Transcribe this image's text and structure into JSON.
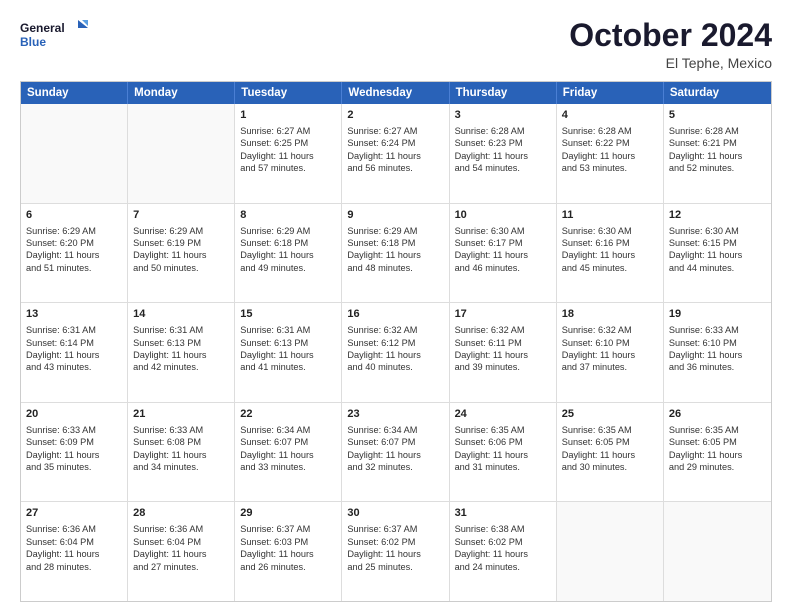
{
  "header": {
    "logo_general": "General",
    "logo_blue": "Blue",
    "month": "October 2024",
    "location": "El Tephe, Mexico"
  },
  "days": [
    "Sunday",
    "Monday",
    "Tuesday",
    "Wednesday",
    "Thursday",
    "Friday",
    "Saturday"
  ],
  "rows": [
    [
      {
        "day": "",
        "empty": true
      },
      {
        "day": "",
        "empty": true
      },
      {
        "day": "1",
        "line1": "Sunrise: 6:27 AM",
        "line2": "Sunset: 6:25 PM",
        "line3": "Daylight: 11 hours",
        "line4": "and 57 minutes."
      },
      {
        "day": "2",
        "line1": "Sunrise: 6:27 AM",
        "line2": "Sunset: 6:24 PM",
        "line3": "Daylight: 11 hours",
        "line4": "and 56 minutes."
      },
      {
        "day": "3",
        "line1": "Sunrise: 6:28 AM",
        "line2": "Sunset: 6:23 PM",
        "line3": "Daylight: 11 hours",
        "line4": "and 54 minutes."
      },
      {
        "day": "4",
        "line1": "Sunrise: 6:28 AM",
        "line2": "Sunset: 6:22 PM",
        "line3": "Daylight: 11 hours",
        "line4": "and 53 minutes."
      },
      {
        "day": "5",
        "line1": "Sunrise: 6:28 AM",
        "line2": "Sunset: 6:21 PM",
        "line3": "Daylight: 11 hours",
        "line4": "and 52 minutes."
      }
    ],
    [
      {
        "day": "6",
        "line1": "Sunrise: 6:29 AM",
        "line2": "Sunset: 6:20 PM",
        "line3": "Daylight: 11 hours",
        "line4": "and 51 minutes."
      },
      {
        "day": "7",
        "line1": "Sunrise: 6:29 AM",
        "line2": "Sunset: 6:19 PM",
        "line3": "Daylight: 11 hours",
        "line4": "and 50 minutes."
      },
      {
        "day": "8",
        "line1": "Sunrise: 6:29 AM",
        "line2": "Sunset: 6:18 PM",
        "line3": "Daylight: 11 hours",
        "line4": "and 49 minutes."
      },
      {
        "day": "9",
        "line1": "Sunrise: 6:29 AM",
        "line2": "Sunset: 6:18 PM",
        "line3": "Daylight: 11 hours",
        "line4": "and 48 minutes."
      },
      {
        "day": "10",
        "line1": "Sunrise: 6:30 AM",
        "line2": "Sunset: 6:17 PM",
        "line3": "Daylight: 11 hours",
        "line4": "and 46 minutes."
      },
      {
        "day": "11",
        "line1": "Sunrise: 6:30 AM",
        "line2": "Sunset: 6:16 PM",
        "line3": "Daylight: 11 hours",
        "line4": "and 45 minutes."
      },
      {
        "day": "12",
        "line1": "Sunrise: 6:30 AM",
        "line2": "Sunset: 6:15 PM",
        "line3": "Daylight: 11 hours",
        "line4": "and 44 minutes."
      }
    ],
    [
      {
        "day": "13",
        "line1": "Sunrise: 6:31 AM",
        "line2": "Sunset: 6:14 PM",
        "line3": "Daylight: 11 hours",
        "line4": "and 43 minutes."
      },
      {
        "day": "14",
        "line1": "Sunrise: 6:31 AM",
        "line2": "Sunset: 6:13 PM",
        "line3": "Daylight: 11 hours",
        "line4": "and 42 minutes."
      },
      {
        "day": "15",
        "line1": "Sunrise: 6:31 AM",
        "line2": "Sunset: 6:13 PM",
        "line3": "Daylight: 11 hours",
        "line4": "and 41 minutes."
      },
      {
        "day": "16",
        "line1": "Sunrise: 6:32 AM",
        "line2": "Sunset: 6:12 PM",
        "line3": "Daylight: 11 hours",
        "line4": "and 40 minutes."
      },
      {
        "day": "17",
        "line1": "Sunrise: 6:32 AM",
        "line2": "Sunset: 6:11 PM",
        "line3": "Daylight: 11 hours",
        "line4": "and 39 minutes."
      },
      {
        "day": "18",
        "line1": "Sunrise: 6:32 AM",
        "line2": "Sunset: 6:10 PM",
        "line3": "Daylight: 11 hours",
        "line4": "and 37 minutes."
      },
      {
        "day": "19",
        "line1": "Sunrise: 6:33 AM",
        "line2": "Sunset: 6:10 PM",
        "line3": "Daylight: 11 hours",
        "line4": "and 36 minutes."
      }
    ],
    [
      {
        "day": "20",
        "line1": "Sunrise: 6:33 AM",
        "line2": "Sunset: 6:09 PM",
        "line3": "Daylight: 11 hours",
        "line4": "and 35 minutes."
      },
      {
        "day": "21",
        "line1": "Sunrise: 6:33 AM",
        "line2": "Sunset: 6:08 PM",
        "line3": "Daylight: 11 hours",
        "line4": "and 34 minutes."
      },
      {
        "day": "22",
        "line1": "Sunrise: 6:34 AM",
        "line2": "Sunset: 6:07 PM",
        "line3": "Daylight: 11 hours",
        "line4": "and 33 minutes."
      },
      {
        "day": "23",
        "line1": "Sunrise: 6:34 AM",
        "line2": "Sunset: 6:07 PM",
        "line3": "Daylight: 11 hours",
        "line4": "and 32 minutes."
      },
      {
        "day": "24",
        "line1": "Sunrise: 6:35 AM",
        "line2": "Sunset: 6:06 PM",
        "line3": "Daylight: 11 hours",
        "line4": "and 31 minutes."
      },
      {
        "day": "25",
        "line1": "Sunrise: 6:35 AM",
        "line2": "Sunset: 6:05 PM",
        "line3": "Daylight: 11 hours",
        "line4": "and 30 minutes."
      },
      {
        "day": "26",
        "line1": "Sunrise: 6:35 AM",
        "line2": "Sunset: 6:05 PM",
        "line3": "Daylight: 11 hours",
        "line4": "and 29 minutes."
      }
    ],
    [
      {
        "day": "27",
        "line1": "Sunrise: 6:36 AM",
        "line2": "Sunset: 6:04 PM",
        "line3": "Daylight: 11 hours",
        "line4": "and 28 minutes."
      },
      {
        "day": "28",
        "line1": "Sunrise: 6:36 AM",
        "line2": "Sunset: 6:04 PM",
        "line3": "Daylight: 11 hours",
        "line4": "and 27 minutes."
      },
      {
        "day": "29",
        "line1": "Sunrise: 6:37 AM",
        "line2": "Sunset: 6:03 PM",
        "line3": "Daylight: 11 hours",
        "line4": "and 26 minutes."
      },
      {
        "day": "30",
        "line1": "Sunrise: 6:37 AM",
        "line2": "Sunset: 6:02 PM",
        "line3": "Daylight: 11 hours",
        "line4": "and 25 minutes."
      },
      {
        "day": "31",
        "line1": "Sunrise: 6:38 AM",
        "line2": "Sunset: 6:02 PM",
        "line3": "Daylight: 11 hours",
        "line4": "and 24 minutes."
      },
      {
        "day": "",
        "empty": true
      },
      {
        "day": "",
        "empty": true
      }
    ]
  ]
}
